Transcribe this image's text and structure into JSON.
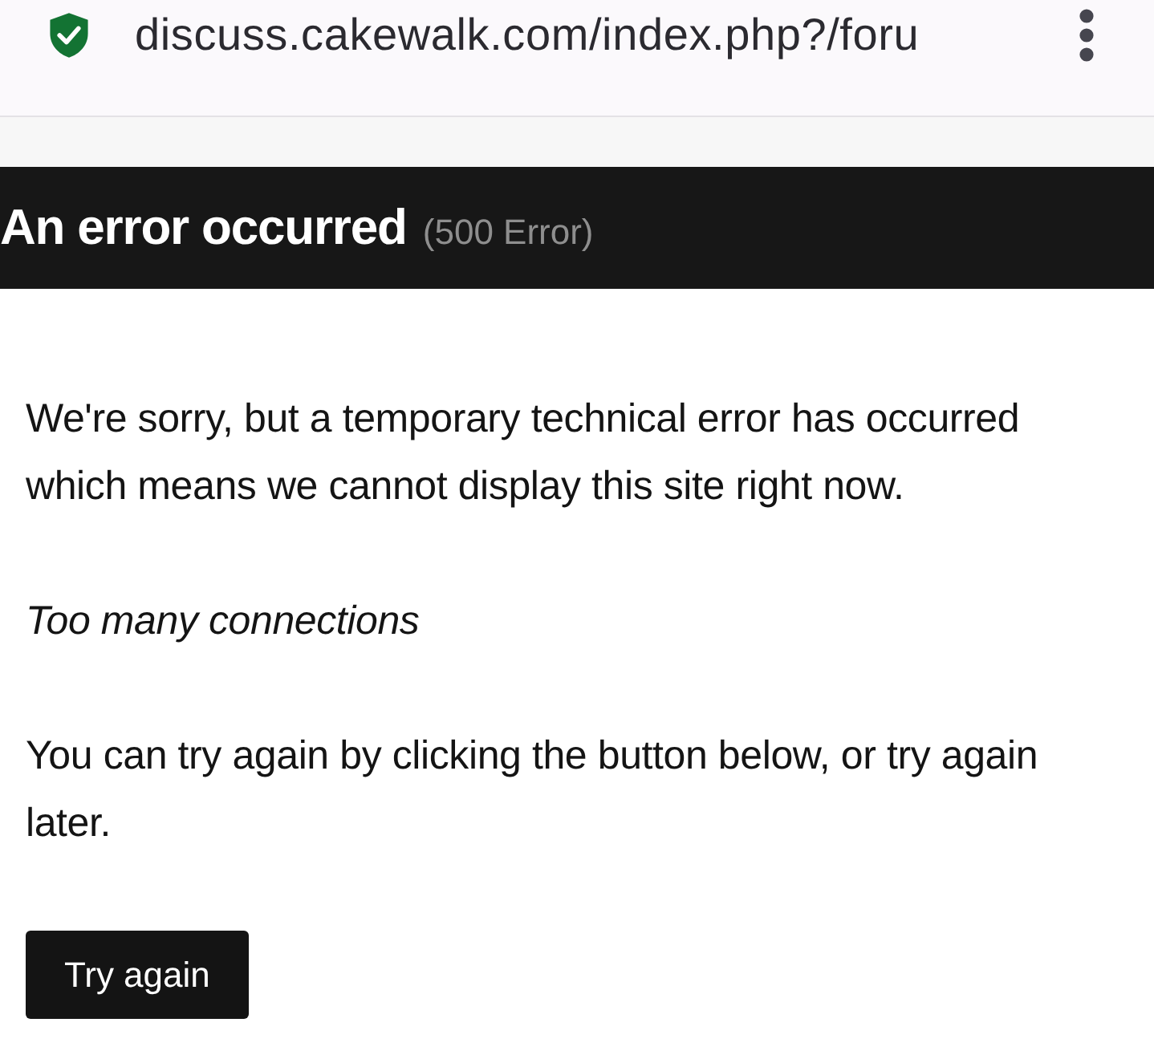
{
  "browser": {
    "url": "discuss.cakewalk.com/index.php?/foru",
    "secure": true
  },
  "header": {
    "title": "An error occurred",
    "code": "(500 Error)"
  },
  "paragraphs": [
    {
      "kind": "plain",
      "text": "We're sorry, but a temporary technical error has occurred which means we cannot display this site right now."
    },
    {
      "kind": "italic",
      "text": "Too many connections"
    },
    {
      "kind": "plain",
      "text": "You can try again by clicking the button below, or try again later."
    }
  ],
  "button": {
    "label": "Try again"
  }
}
